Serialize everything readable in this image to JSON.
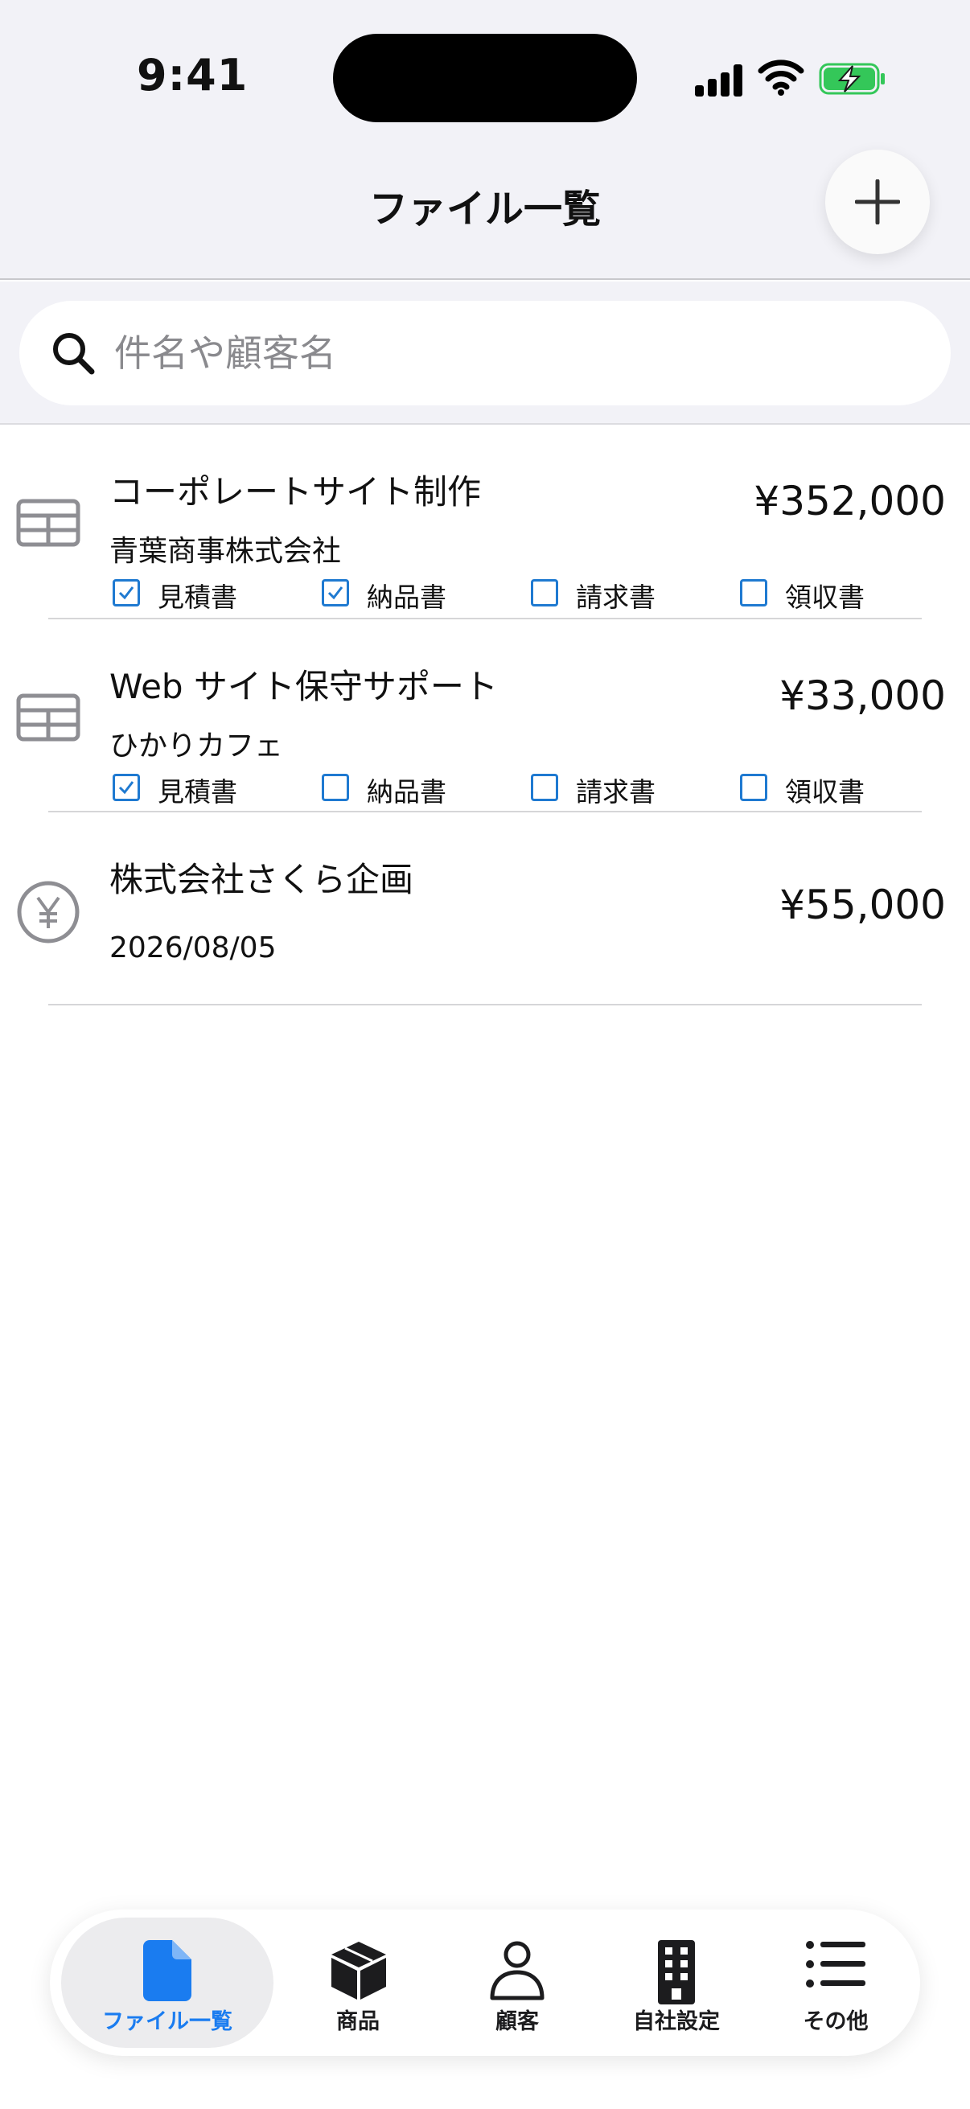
{
  "status_bar": {
    "time": "9:41"
  },
  "header": {
    "title": "ファイル一覧"
  },
  "search": {
    "placeholder": "件名や顧客名",
    "value": ""
  },
  "colors": {
    "accent": "#1a7cf0",
    "checkbox": "#1f7ad1",
    "background": "#f2f2f7",
    "icon_gray": "#8e8e93",
    "battery_green": "#34c759"
  },
  "documents": [
    {
      "icon": "table-icon",
      "title": "コーポレートサイト制作",
      "subtitle": "青葉商事株式会社",
      "amount": "¥352,000",
      "checks": [
        {
          "label": "見積書",
          "checked": true
        },
        {
          "label": "納品書",
          "checked": true
        },
        {
          "label": "請求書",
          "checked": false
        },
        {
          "label": "領収書",
          "checked": false
        }
      ]
    },
    {
      "icon": "table-icon",
      "title": "Web サイト保守サポート",
      "subtitle": "ひかりカフェ",
      "amount": "¥33,000",
      "checks": [
        {
          "label": "見積書",
          "checked": true
        },
        {
          "label": "納品書",
          "checked": false
        },
        {
          "label": "請求書",
          "checked": false
        },
        {
          "label": "領収書",
          "checked": false
        }
      ]
    },
    {
      "icon": "yen-circle-icon",
      "title": "株式会社さくら企画",
      "date": "2026/08/05",
      "amount": "¥55,000"
    }
  ],
  "tabs": [
    {
      "label": "ファイル一覧",
      "icon": "document-icon",
      "active": true
    },
    {
      "label": "商品",
      "icon": "box-icon",
      "active": false
    },
    {
      "label": "顧客",
      "icon": "person-icon",
      "active": false
    },
    {
      "label": "自社設定",
      "icon": "building-icon",
      "active": false
    },
    {
      "label": "その他",
      "icon": "list-icon",
      "active": false
    }
  ]
}
